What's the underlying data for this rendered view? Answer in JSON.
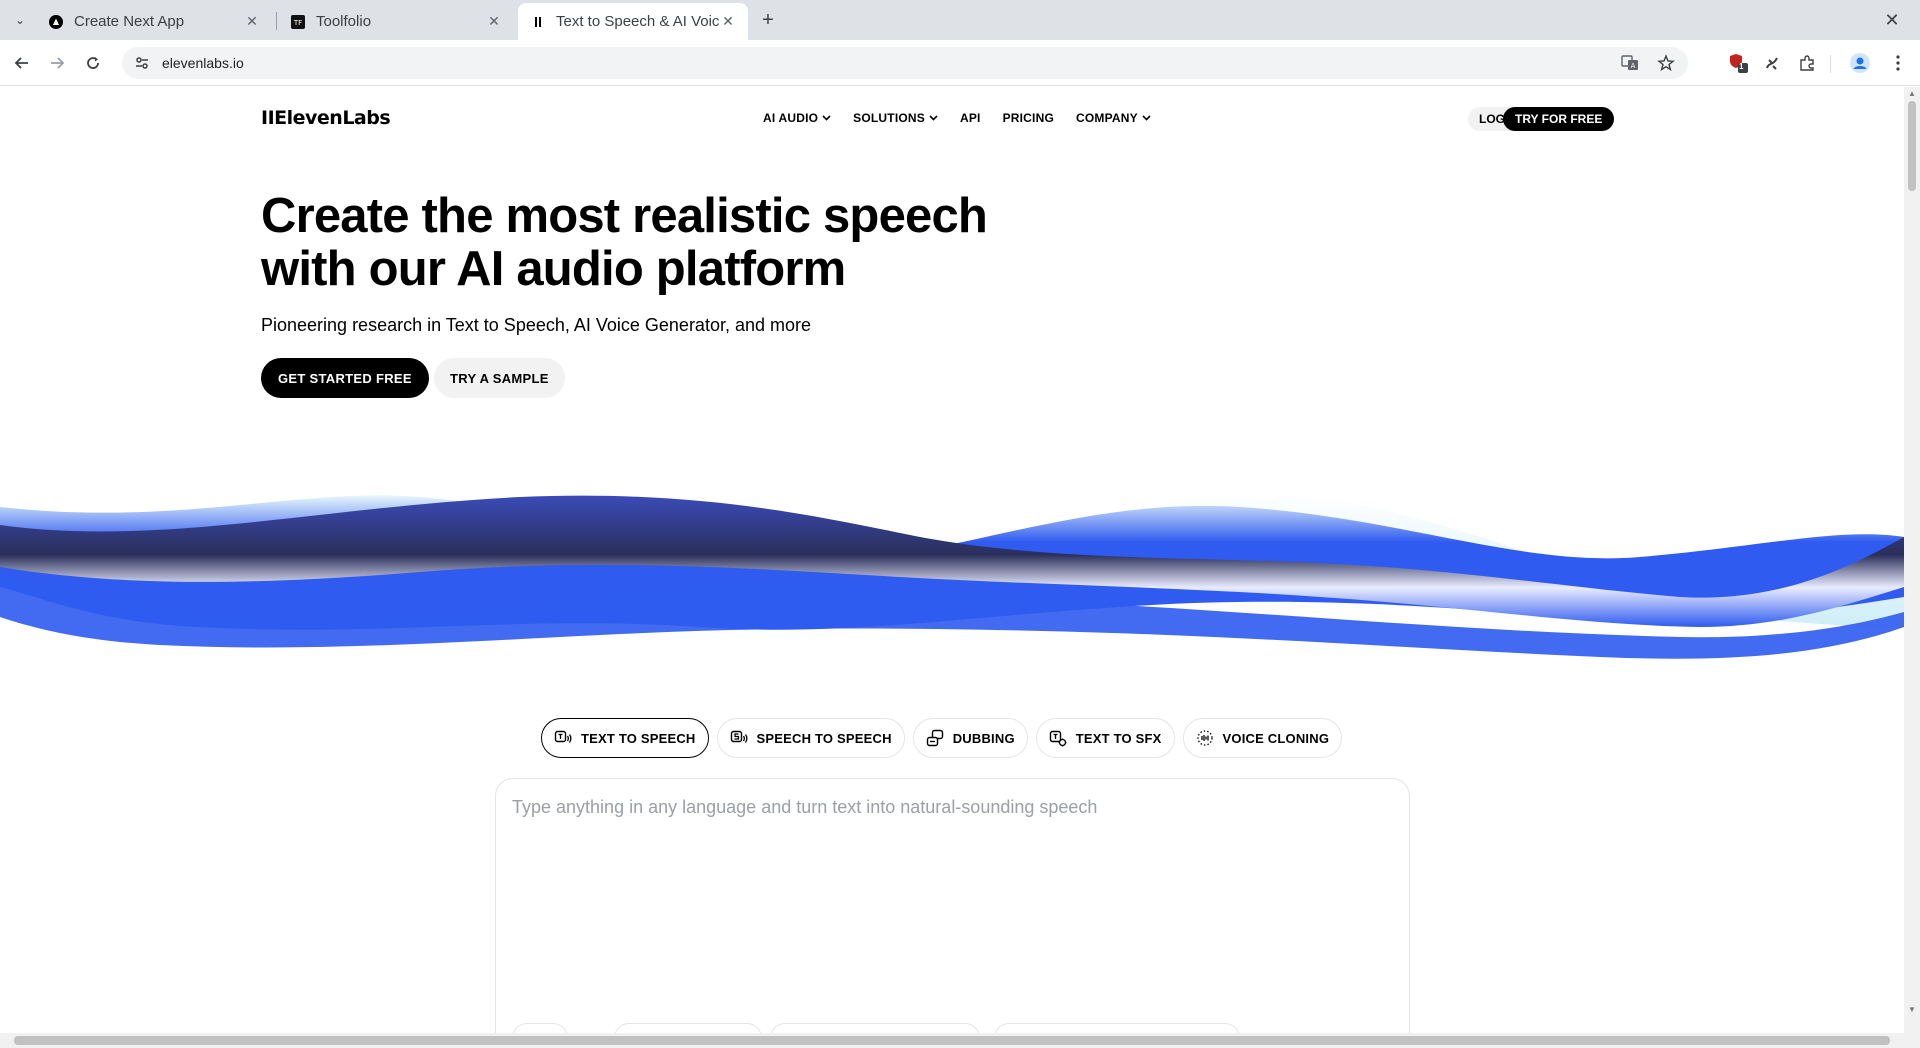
{
  "browser": {
    "tabs": [
      {
        "title": "Create Next App",
        "icon": "nextjs-icon"
      },
      {
        "title": "Toolfolio",
        "icon": "toolfolio-icon"
      },
      {
        "title": "Text to Speech & AI Voice",
        "icon": "elevenlabs-icon"
      }
    ],
    "url": "elevenlabs.io",
    "extension_badge": "1"
  },
  "site": {
    "logo": "IIElevenLabs",
    "nav": [
      {
        "label": "AI AUDIO",
        "dropdown": true
      },
      {
        "label": "SOLUTIONS",
        "dropdown": true
      },
      {
        "label": "API",
        "dropdown": false
      },
      {
        "label": "PRICING",
        "dropdown": false
      },
      {
        "label": "COMPANY",
        "dropdown": true
      }
    ],
    "login": "LOG IN",
    "try_free": "TRY FOR FREE"
  },
  "hero": {
    "title_line1": "Create the most realistic speech",
    "title_line2": "with our AI audio platform",
    "subtitle": "Pioneering research in Text to Speech, AI Voice Generator, and more",
    "cta_primary": "GET STARTED FREE",
    "cta_secondary": "TRY A SAMPLE"
  },
  "modes": [
    {
      "label": "TEXT TO SPEECH",
      "icon": "text-to-speech-icon",
      "active": true
    },
    {
      "label": "SPEECH TO SPEECH",
      "icon": "speech-to-speech-icon",
      "active": false
    },
    {
      "label": "DUBBING",
      "icon": "dubbing-icon",
      "active": false
    },
    {
      "label": "TEXT TO SFX",
      "icon": "text-to-sfx-icon",
      "active": false
    },
    {
      "label": "VOICE CLONING",
      "icon": "voice-cloning-icon",
      "active": false
    }
  ],
  "editor": {
    "placeholder": "Type anything in any language and turn text into natural-sounding speech"
  },
  "colors": {
    "wave_blue": "#2f5bf0",
    "wave_dark": "#2a2f5a",
    "wave_light": "#dff3fb"
  }
}
